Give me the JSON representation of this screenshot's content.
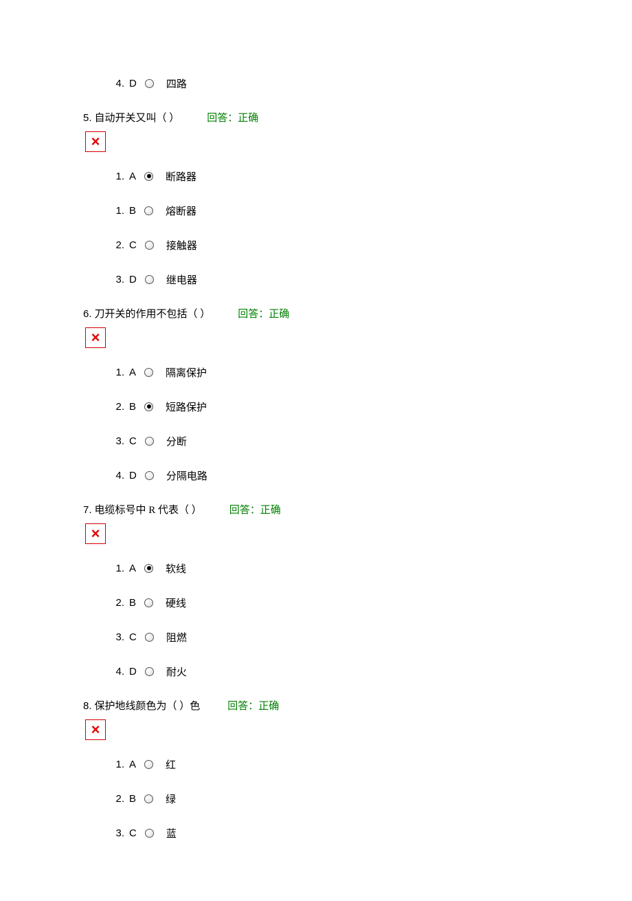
{
  "leading_option": {
    "num": "4.",
    "letter": "D",
    "text": "四路",
    "checked": false
  },
  "feedback_label_prefix": "回答：",
  "questions": [
    {
      "num": "5.",
      "text": "自动开关又叫（ ）",
      "feedback": "正确",
      "x_mark": "×",
      "options": [
        {
          "num": "1.",
          "letter": "A",
          "text": "断路器",
          "checked": true
        },
        {
          "num": "1.",
          "letter": "B",
          "text": "熔断器",
          "checked": false
        },
        {
          "num": "2.",
          "letter": "C",
          "text": "接触器",
          "checked": false
        },
        {
          "num": "3.",
          "letter": "D",
          "text": "继电器",
          "checked": false
        }
      ]
    },
    {
      "num": "6.",
      "text": "刀开关的作用不包括（ ）",
      "feedback": "正确",
      "x_mark": "×",
      "options": [
        {
          "num": "1.",
          "letter": "A",
          "text": "隔离保护",
          "checked": false
        },
        {
          "num": "2.",
          "letter": "B",
          "text": "短路保护",
          "checked": true
        },
        {
          "num": "3.",
          "letter": "C",
          "text": "分断",
          "checked": false
        },
        {
          "num": "4.",
          "letter": "D",
          "text": "分隔电路",
          "checked": false
        }
      ]
    },
    {
      "num": "7.",
      "text": "电缆标号中 R 代表（ ）",
      "feedback": "正确",
      "x_mark": "×",
      "options": [
        {
          "num": "1.",
          "letter": "A",
          "text": "软线",
          "checked": true
        },
        {
          "num": "2.",
          "letter": "B",
          "text": "硬线",
          "checked": false
        },
        {
          "num": "3.",
          "letter": "C",
          "text": "阻燃",
          "checked": false
        },
        {
          "num": "4.",
          "letter": "D",
          "text": "耐火",
          "checked": false
        }
      ]
    },
    {
      "num": "8.",
      "text": "保护地线颜色为（ ）色",
      "feedback": "正确",
      "x_mark": "×",
      "options": [
        {
          "num": "1.",
          "letter": "A",
          "text": "红",
          "checked": false
        },
        {
          "num": "2.",
          "letter": "B",
          "text": "绿",
          "checked": false
        },
        {
          "num": "3.",
          "letter": "C",
          "text": "蓝",
          "checked": false
        }
      ]
    }
  ]
}
